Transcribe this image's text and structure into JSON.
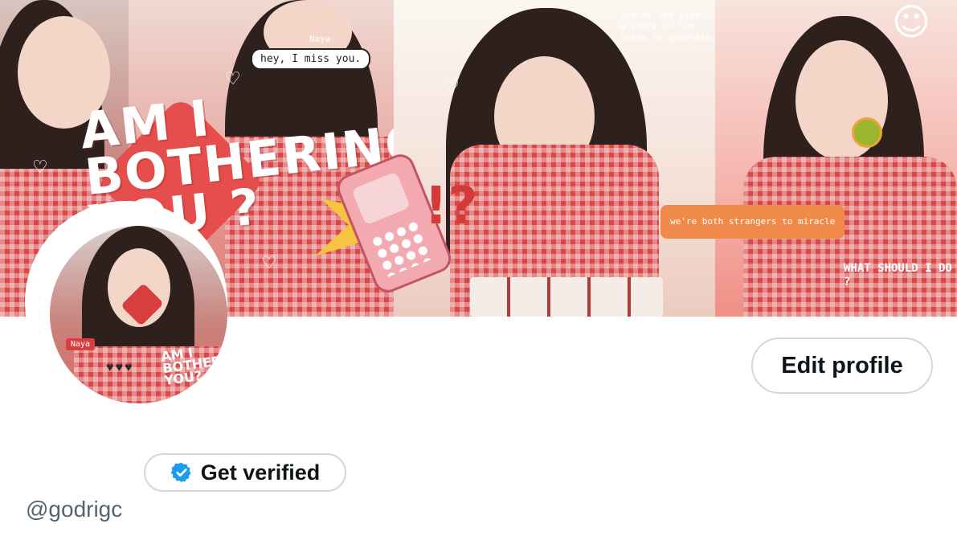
{
  "banner": {
    "headline": "AM I\nBOTHERING\nYOU ?",
    "speech_bubble": "hey, I miss you.",
    "name_tag": "Naya",
    "top_note": "out of the blue, a spark or two\nseems to generate",
    "sticker_note": "we're both\nstrangers\nto miracle",
    "bottom_note": "WHAT SHOULD\nI DO ?",
    "accent": "#e64d4d"
  },
  "avatar": {
    "tag": "Naya",
    "text": "AM I\nBOTHERING\nYOU?"
  },
  "profile": {
    "edit_label": "Edit profile",
    "verify_label": "Get verified",
    "handle": "@godrigc",
    "verify_icon": "verified-badge-icon",
    "verify_color": "#1d9bf0"
  }
}
